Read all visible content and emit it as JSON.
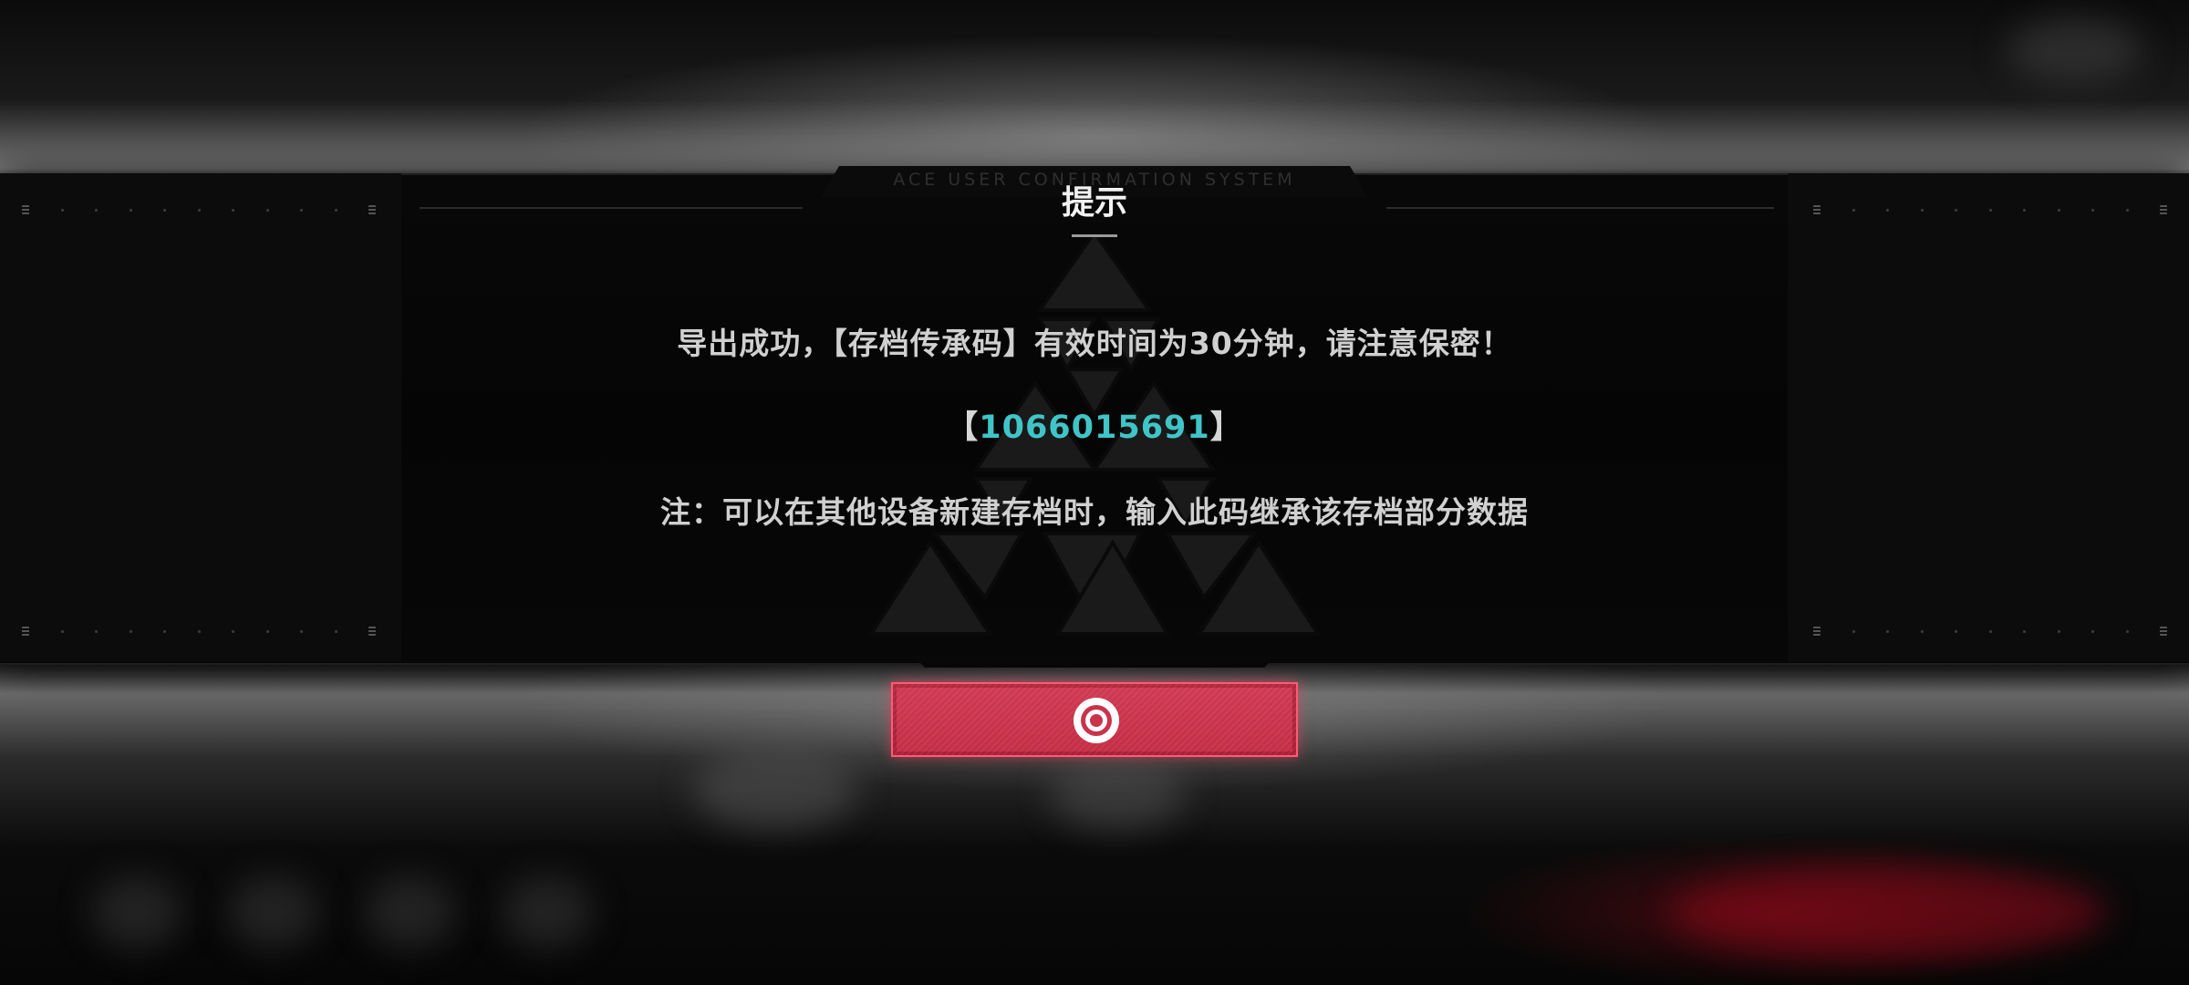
{
  "dialog": {
    "system_label": "ACE USER CONFIRMATION SYSTEM",
    "title": "提示",
    "message_line1": "导出成功，【存档传承码】有效时间为30分钟，请注意保密！",
    "code_open_bracket": "【",
    "code_value": "1066015691",
    "code_close_bracket": "】",
    "message_line2": "注：可以在其他设备新建存档时，输入此码继承该存档部分数据",
    "confirm_icon": "circle-confirm-icon"
  },
  "colors": {
    "accent_red": "#c9334b",
    "code_cyan": "#3fc5c8",
    "text_light": "#d0d0d0"
  }
}
